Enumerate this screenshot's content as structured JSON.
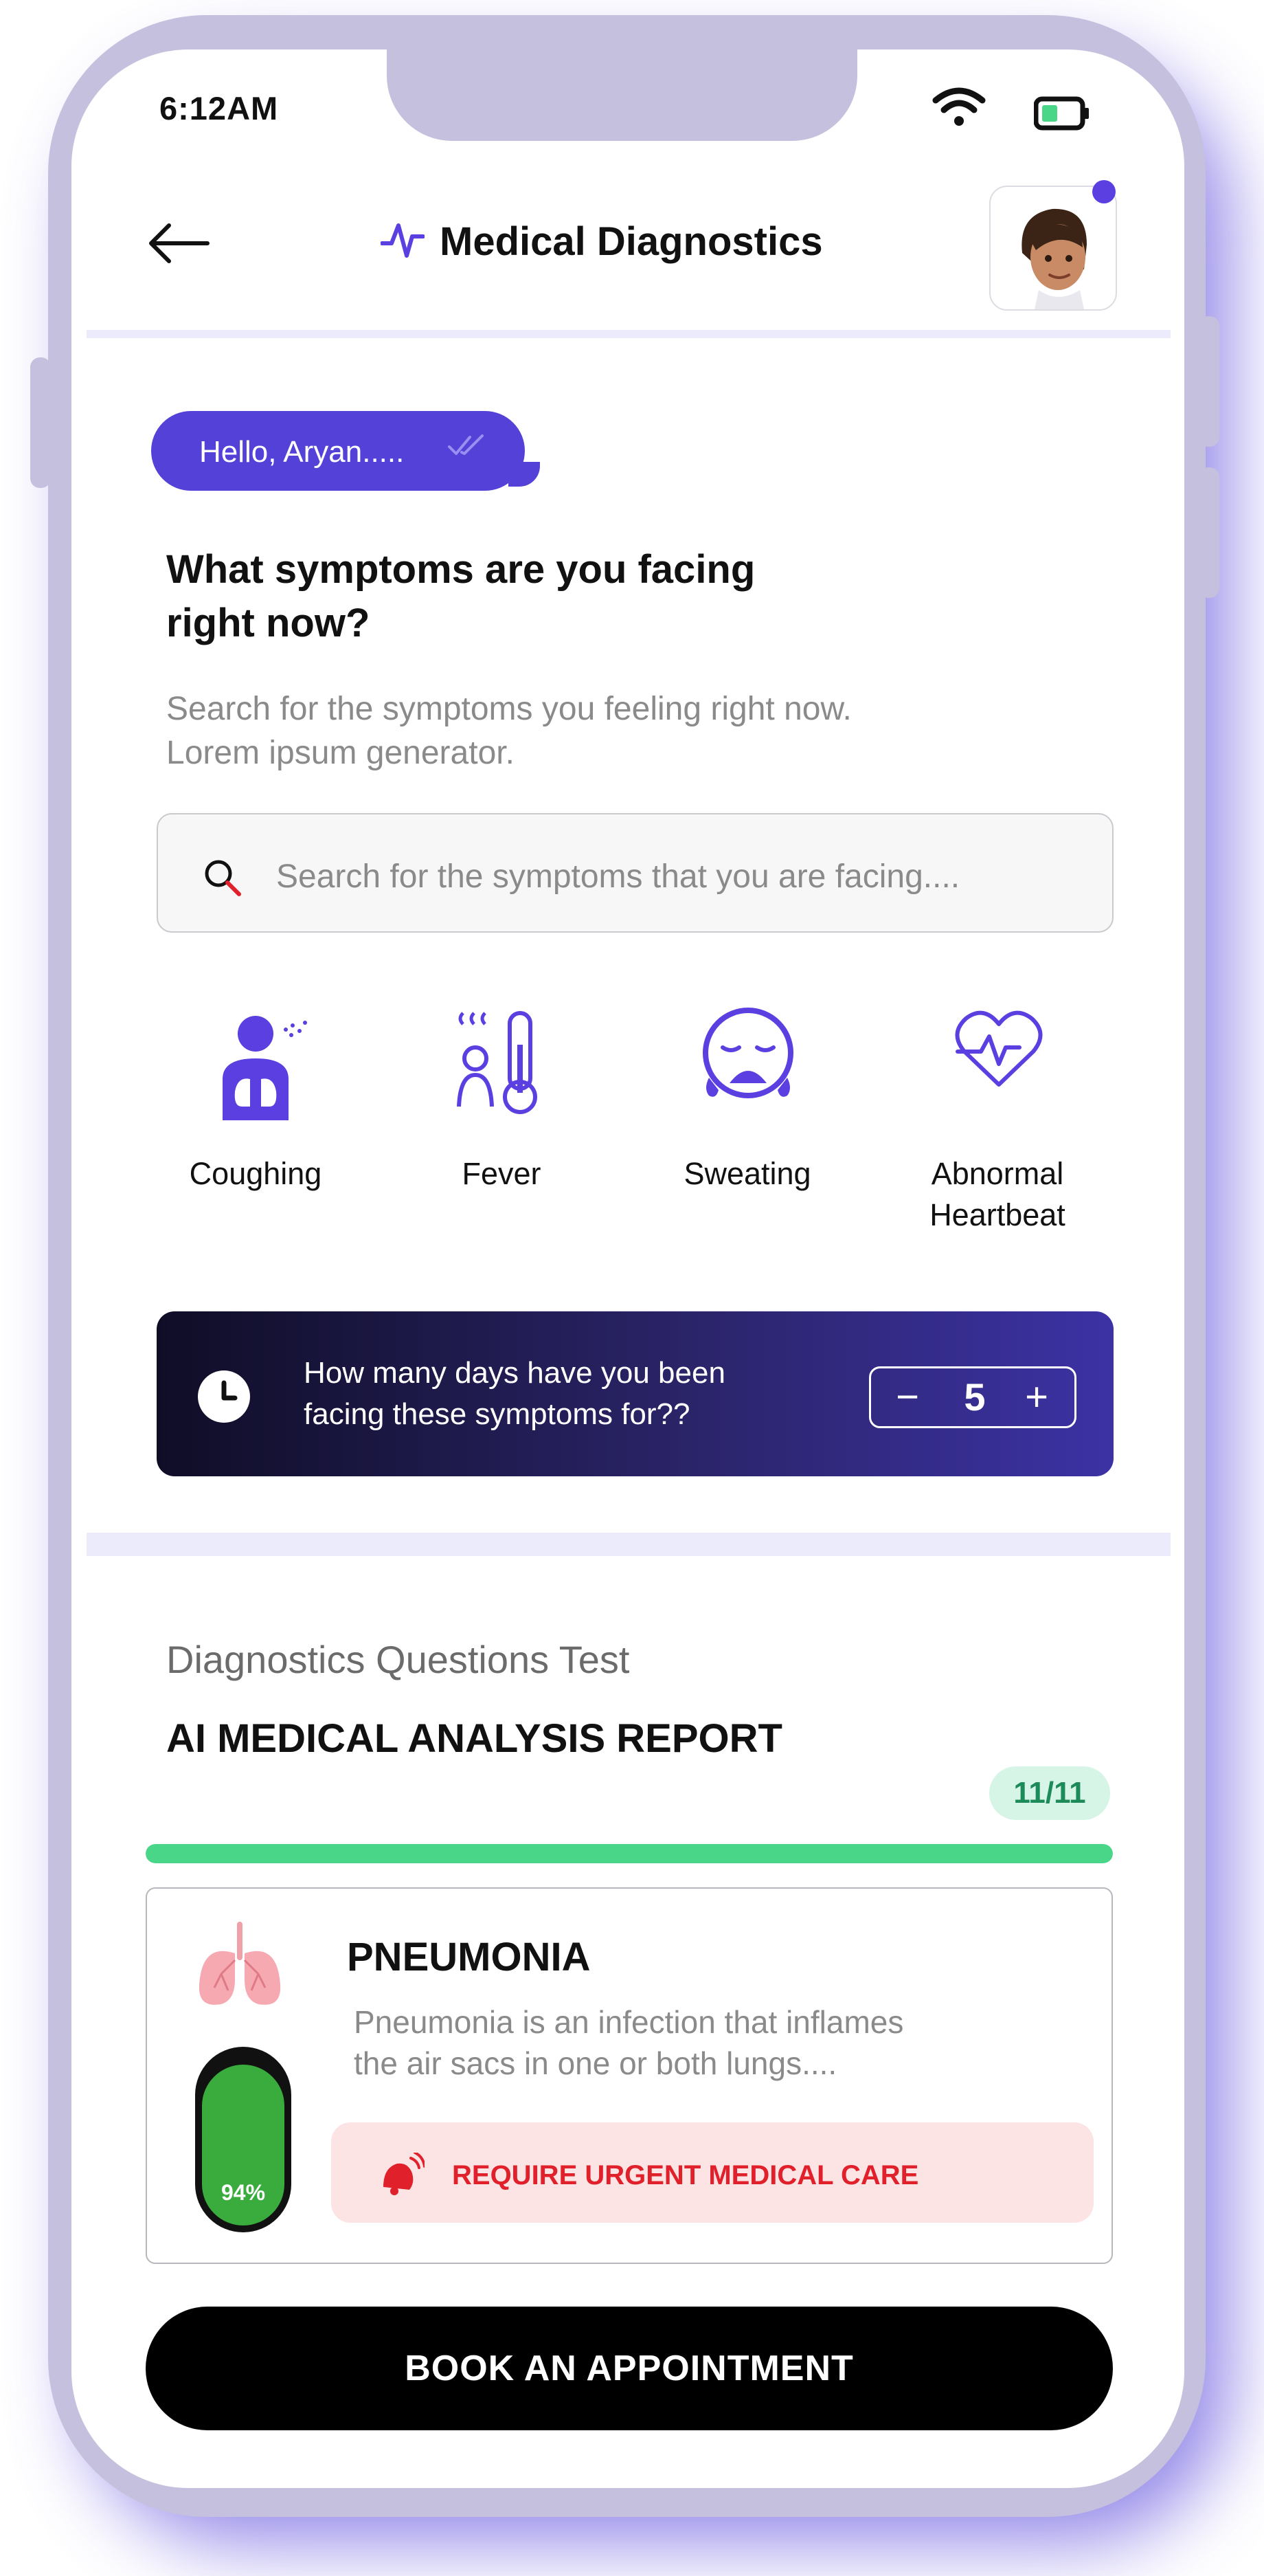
{
  "status_bar": {
    "time": "6:12AM",
    "wifi_icon": "wifi-icon",
    "battery_icon": "battery-icon"
  },
  "header": {
    "title": "Medical Diagnostics",
    "back_icon": "arrow-left-icon",
    "pulse_icon": "pulse-icon",
    "brand_color": "#5b3fe0"
  },
  "greeting": {
    "text": "Hello,  Aryan.....",
    "check_icon": "double-check-icon"
  },
  "prompt": {
    "question_line1": "What symptoms are you facing",
    "question_line2": "right now?",
    "sub_line1": "Search for the symptoms you feeling right now.",
    "sub_line2": "Lorem ipsum generator."
  },
  "search": {
    "placeholder": "Search for the symptoms that you are facing...."
  },
  "symptoms": [
    {
      "label_line1": "Coughing",
      "label_line2": "",
      "icon": "coughing-icon"
    },
    {
      "label_line1": "Fever",
      "label_line2": "",
      "icon": "fever-icon"
    },
    {
      "label_line1": "Sweating",
      "label_line2": "",
      "icon": "sweating-icon"
    },
    {
      "label_line1": "Abnormal",
      "label_line2": "Heartbeat",
      "icon": "heartbeat-icon"
    }
  ],
  "duration": {
    "line1": "How many days have you been",
    "line2": "facing these symptoms for??",
    "value": "5",
    "minus": "−",
    "plus": "+"
  },
  "report": {
    "subtitle": "Diagnostics Questions Test",
    "title": "AI MEDICAL ANALYSIS REPORT",
    "count": "11/11",
    "progress": 1.0,
    "progress_color": "#4ad688",
    "disease": {
      "name": "PNEUMONIA",
      "desc_line1": "Pneumonia is an infection that inflames",
      "desc_line2": "the air sacs in one or both lungs....",
      "confidence": "94%",
      "confidence_value": 0.94,
      "meter_color": "#3aac3e",
      "urgency": "REQUIRE URGENT MEDICAL CARE",
      "urgency_color": "#e0202a"
    }
  },
  "cta": {
    "label": "BOOK AN APPOINTMENT"
  }
}
